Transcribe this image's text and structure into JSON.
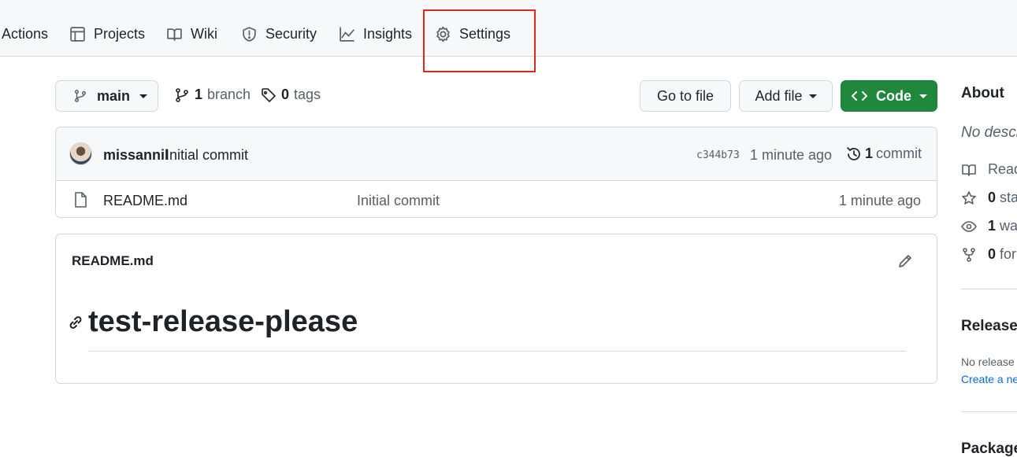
{
  "repo_nav": {
    "tabs": [
      {
        "label": "Actions",
        "icon": "play-icon"
      },
      {
        "label": "Projects",
        "icon": "table-icon"
      },
      {
        "label": "Wiki",
        "icon": "book-icon"
      },
      {
        "label": "Security",
        "icon": "shield-icon"
      },
      {
        "label": "Insights",
        "icon": "graph-icon"
      },
      {
        "label": "Settings",
        "icon": "gear-icon"
      }
    ],
    "highlight_color": "#e0261d"
  },
  "toolbar": {
    "branch_name": "main",
    "branch_count": "1",
    "branch_label": "branch",
    "tag_count": "0",
    "tag_label": "tags",
    "go_to_file": "Go to file",
    "add_file": "Add file",
    "code": "Code",
    "code_color": "#1f883d"
  },
  "commit": {
    "author": "missannil",
    "message": "Initial commit",
    "sha": "c344b73",
    "time": "1 minute ago",
    "count": "1",
    "count_label": "commit"
  },
  "files": [
    {
      "name": "README.md",
      "message": "Initial commit",
      "time": "1 minute ago"
    }
  ],
  "readme": {
    "title": "README.md",
    "heading": "test-release-please"
  },
  "sidebar": {
    "about_heading": "About",
    "description": "No descr",
    "readme_label": "Read",
    "stars_count": "0",
    "stars_label": "sta",
    "watch_count": "1",
    "watch_label": "wat",
    "forks_count": "0",
    "forks_label": "for",
    "releases_heading": "Releases",
    "releases_text": "No release",
    "releases_link": "Create a ne",
    "packages_heading": "Package"
  }
}
